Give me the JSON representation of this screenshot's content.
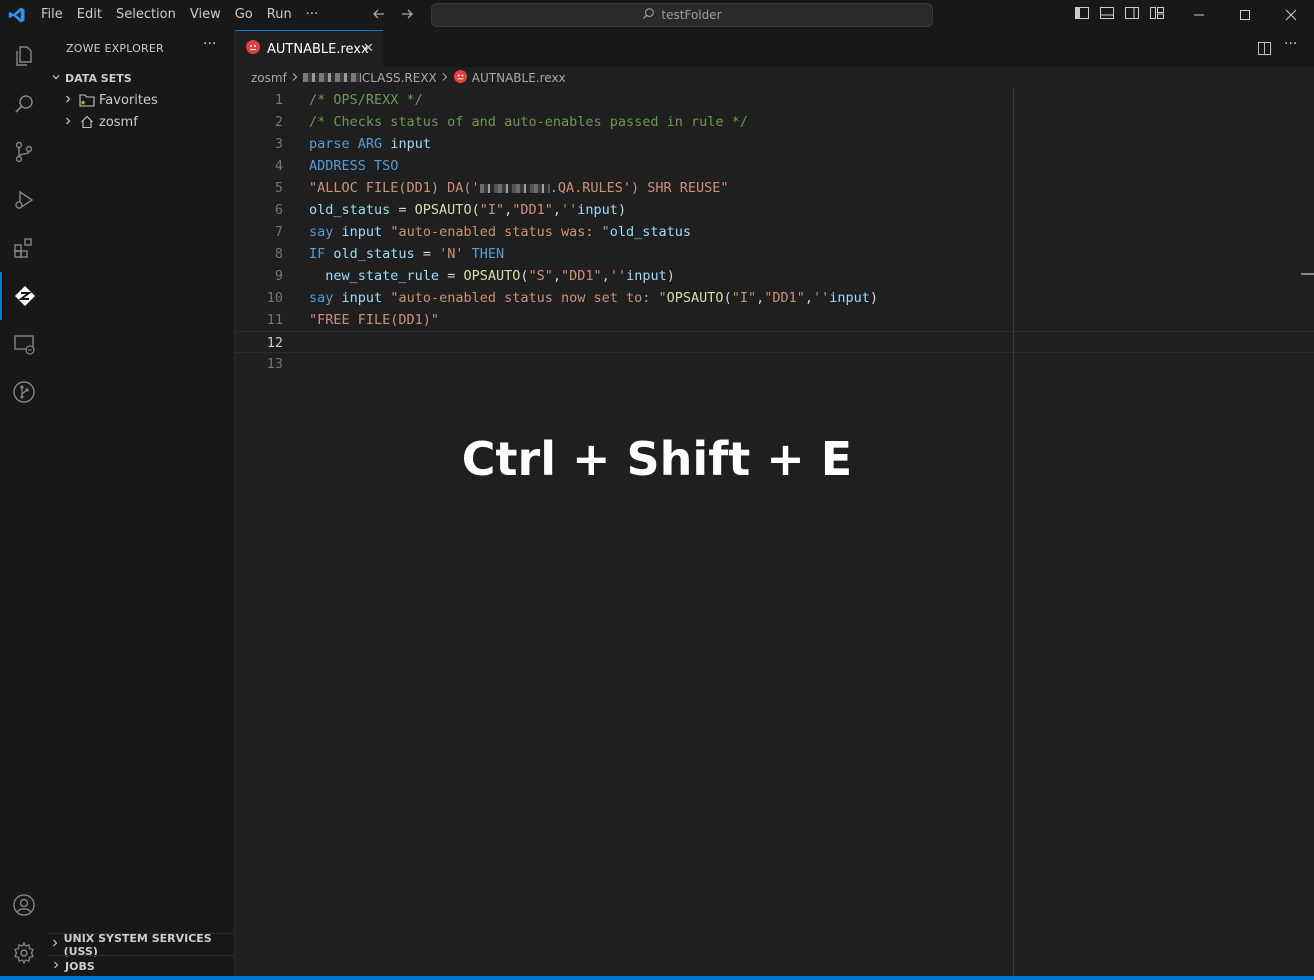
{
  "menu": [
    "File",
    "Edit",
    "Selection",
    "View",
    "Go",
    "Run",
    "···"
  ],
  "search": {
    "text": "testFolder"
  },
  "sidebar": {
    "title": "ZOWE EXPLORER",
    "more": "···",
    "sections": {
      "datasets": "DATA SETS",
      "uss": "UNIX SYSTEM SERVICES (USS)",
      "jobs": "JOBS"
    },
    "items": [
      "Favorites",
      "zosmf"
    ]
  },
  "tab": {
    "label": "AUTNABLE.rexx",
    "close": "✕"
  },
  "breadcrumb": {
    "root": "zosmf",
    "folder_suffix": "CLASS.REXX",
    "file": "AUTNABLE.rexx"
  },
  "code_lines": [
    "1",
    "2",
    "3",
    "4",
    "5",
    "6",
    "7",
    "8",
    "9",
    "10",
    "11",
    "12",
    "13"
  ],
  "code_text": {
    "l1": "/* OPS/REXX */",
    "l2": "/* Checks status of and auto-enables passed in rule */",
    "l3_kw1": "parse",
    "l3_kw2": "ARG",
    "l3_id": "input",
    "l4_kw1": "ADDRESS",
    "l4_kw2": "TSO",
    "l5_a": "\"ALLOC FILE(DD1) DA('",
    "l5_b": ".QA.RULES') SHR REUSE\"",
    "l6_id": "old_status",
    "l6_eq": " = ",
    "l6_fn": "OPSAUTO",
    "l6_p1": "(",
    "l6_s1": "\"I\"",
    "l6_c": ",",
    "l6_s2": "\"DD1\"",
    "l6_c2": ",",
    "l6_s3": "''",
    "l6_id2": "input",
    "l6_p2": ")",
    "l7_kw": "say",
    "l7_id": "input",
    "l7_s": "\"auto-enabled status was: \"",
    "l7_id2": "old_status",
    "l8_kw": "IF",
    "l8_id": "old_status",
    "l8_eq": " = ",
    "l8_s": "'N'",
    "l8_kw2": "THEN",
    "l9_id": "new_state_rule",
    "l9_eq": " = ",
    "l9_fn": "OPSAUTO",
    "l9_p1": "(",
    "l9_s1": "\"S\"",
    "l9_c": ",",
    "l9_s2": "\"DD1\"",
    "l9_c2": ",",
    "l9_s3": "''",
    "l9_id2": "input",
    "l9_p2": ")",
    "l10_kw": "say",
    "l10_id": "input",
    "l10_s": "\"auto-enabled status now set to: \"",
    "l10_fn": "OPSAUTO",
    "l10_p1": "(",
    "l10_s1": "\"I\"",
    "l10_c": ",",
    "l10_s2": "\"DD1\"",
    "l10_c2": ",",
    "l10_s3": "''",
    "l10_id2": "input",
    "l10_p2": ")",
    "l11": "\"FREE FILE(DD1)\""
  },
  "overlay": "Ctrl + Shift + E",
  "colors": {
    "accent": "#0078d4",
    "comment": "#6a9955",
    "keyword": "#569cd6",
    "string": "#ce9178",
    "identifier": "#9cdcfe"
  },
  "icons": [
    "vscode-logo-icon",
    "explorer-icon",
    "search-icon",
    "source-control-icon",
    "run-debug-icon",
    "extensions-icon",
    "zowe-icon",
    "remote-explorer-icon",
    "git-graph-icon",
    "accounts-icon",
    "settings-gear-icon"
  ]
}
